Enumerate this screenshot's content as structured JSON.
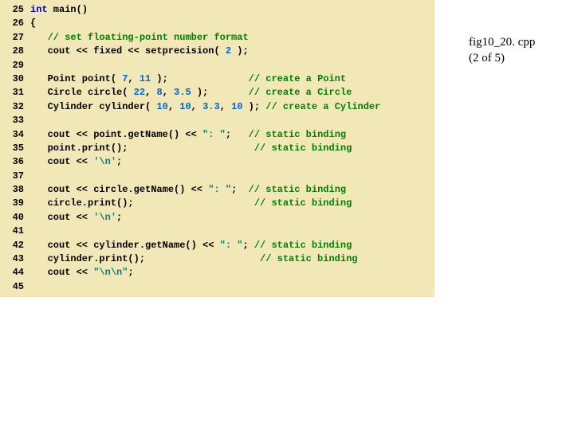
{
  "caption": {
    "line1": "fig10_20. cpp",
    "line2": "(2 of 5)"
  },
  "lines": [
    {
      "n": "25",
      "segs": [
        {
          "c": "kw",
          "t": "int"
        },
        {
          "c": "txt",
          "t": " main()"
        }
      ]
    },
    {
      "n": "26",
      "segs": [
        {
          "c": "txt",
          "t": "{"
        }
      ]
    },
    {
      "n": "27",
      "segs": [
        {
          "c": "txt",
          "t": "   "
        },
        {
          "c": "com",
          "t": "// set floating-point number format"
        }
      ]
    },
    {
      "n": "28",
      "segs": [
        {
          "c": "txt",
          "t": "   cout << fixed << setprecision( "
        },
        {
          "c": "num",
          "t": "2"
        },
        {
          "c": "txt",
          "t": " );"
        }
      ]
    },
    {
      "n": "29",
      "segs": [
        {
          "c": "txt",
          "t": ""
        }
      ]
    },
    {
      "n": "30",
      "segs": [
        {
          "c": "txt",
          "t": "   Point point( "
        },
        {
          "c": "num",
          "t": "7"
        },
        {
          "c": "txt",
          "t": ", "
        },
        {
          "c": "num",
          "t": "11"
        },
        {
          "c": "txt",
          "t": " );              "
        },
        {
          "c": "com",
          "t": "// create a Point"
        }
      ]
    },
    {
      "n": "31",
      "segs": [
        {
          "c": "txt",
          "t": "   Circle circle( "
        },
        {
          "c": "num",
          "t": "22"
        },
        {
          "c": "txt",
          "t": ", "
        },
        {
          "c": "num",
          "t": "8"
        },
        {
          "c": "txt",
          "t": ", "
        },
        {
          "c": "num",
          "t": "3.5"
        },
        {
          "c": "txt",
          "t": " );       "
        },
        {
          "c": "com",
          "t": "// create a Circle"
        }
      ]
    },
    {
      "n": "32",
      "segs": [
        {
          "c": "txt",
          "t": "   Cylinder cylinder( "
        },
        {
          "c": "num",
          "t": "10"
        },
        {
          "c": "txt",
          "t": ", "
        },
        {
          "c": "num",
          "t": "10"
        },
        {
          "c": "txt",
          "t": ", "
        },
        {
          "c": "num",
          "t": "3.3"
        },
        {
          "c": "txt",
          "t": ", "
        },
        {
          "c": "num",
          "t": "10"
        },
        {
          "c": "txt",
          "t": " ); "
        },
        {
          "c": "com",
          "t": "// create a Cylinder"
        }
      ]
    },
    {
      "n": "33",
      "segs": [
        {
          "c": "txt",
          "t": ""
        }
      ]
    },
    {
      "n": "34",
      "segs": [
        {
          "c": "txt",
          "t": "   cout << point.getName() << "
        },
        {
          "c": "str",
          "t": "\": \""
        },
        {
          "c": "txt",
          "t": ";   "
        },
        {
          "c": "com",
          "t": "// static binding"
        }
      ]
    },
    {
      "n": "35",
      "segs": [
        {
          "c": "txt",
          "t": "   point.print();                      "
        },
        {
          "c": "com",
          "t": "// static binding"
        }
      ]
    },
    {
      "n": "36",
      "segs": [
        {
          "c": "txt",
          "t": "   cout << "
        },
        {
          "c": "str",
          "t": "'\\n'"
        },
        {
          "c": "txt",
          "t": ";"
        }
      ]
    },
    {
      "n": "37",
      "segs": [
        {
          "c": "txt",
          "t": ""
        }
      ]
    },
    {
      "n": "38",
      "segs": [
        {
          "c": "txt",
          "t": "   cout << circle.getName() << "
        },
        {
          "c": "str",
          "t": "\": \""
        },
        {
          "c": "txt",
          "t": ";  "
        },
        {
          "c": "com",
          "t": "// static binding"
        }
      ]
    },
    {
      "n": "39",
      "segs": [
        {
          "c": "txt",
          "t": "   circle.print();                     "
        },
        {
          "c": "com",
          "t": "// static binding"
        }
      ]
    },
    {
      "n": "40",
      "segs": [
        {
          "c": "txt",
          "t": "   cout << "
        },
        {
          "c": "str",
          "t": "'\\n'"
        },
        {
          "c": "txt",
          "t": ";"
        }
      ]
    },
    {
      "n": "41",
      "segs": [
        {
          "c": "txt",
          "t": ""
        }
      ]
    },
    {
      "n": "42",
      "segs": [
        {
          "c": "txt",
          "t": "   cout << cylinder.getName() << "
        },
        {
          "c": "str",
          "t": "\": \""
        },
        {
          "c": "txt",
          "t": "; "
        },
        {
          "c": "com",
          "t": "// static binding"
        }
      ]
    },
    {
      "n": "43",
      "segs": [
        {
          "c": "txt",
          "t": "   cylinder.print();                    "
        },
        {
          "c": "com",
          "t": "// static binding"
        }
      ]
    },
    {
      "n": "44",
      "segs": [
        {
          "c": "txt",
          "t": "   cout << "
        },
        {
          "c": "str",
          "t": "\"\\n\\n\""
        },
        {
          "c": "txt",
          "t": ";"
        }
      ]
    },
    {
      "n": "45",
      "segs": [
        {
          "c": "txt",
          "t": ""
        }
      ]
    }
  ]
}
